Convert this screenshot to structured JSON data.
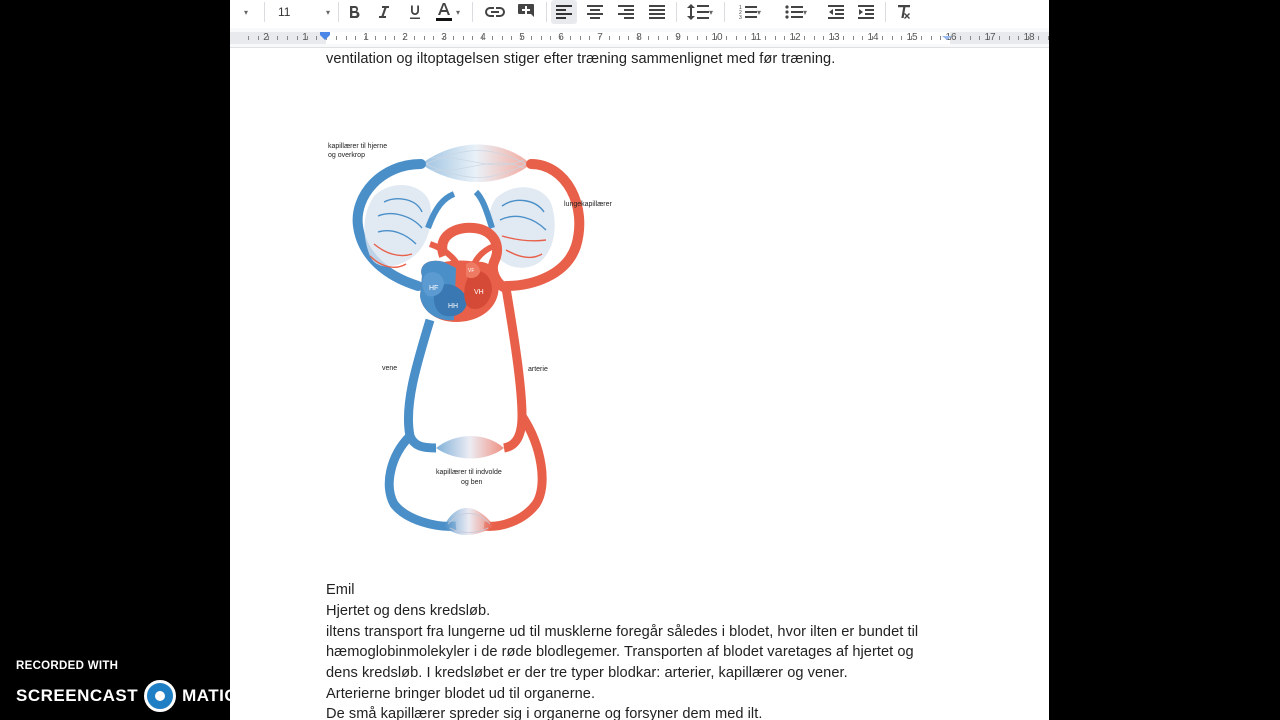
{
  "toolbar": {
    "font_size": "11",
    "font_size_caret": "▾",
    "style_caret": "▾"
  },
  "ruler": {
    "numbers": [
      "2",
      "1",
      "1",
      "2",
      "3",
      "4",
      "5",
      "6",
      "7",
      "8",
      "9",
      "10",
      "11",
      "12",
      "13",
      "14",
      "15",
      "16",
      "17",
      "18"
    ]
  },
  "document": {
    "top_line": "ventilation og iltoptagelsen stiger efter træning sammenlignet med før træning.",
    "figure": {
      "label_brain": "kapillærer til hjerne",
      "label_brain2": "og overkrop",
      "label_lung": "lungekapillærer",
      "label_vene": "vene",
      "label_arterie": "arterie",
      "label_gut": "kapillærer til indvolde",
      "label_gut2": "og ben",
      "label_hf": "HF",
      "label_hh": "HH",
      "label_vh": "VH",
      "label_vf": "VF"
    },
    "lines": [
      "Emil",
      "Hjertet og dens kredsløb.",
      "iltens transport fra lungerne ud til musklerne foregår således i blodet, hvor ilten er bundet til",
      "hæmoglobinmolekyler i de røde blodlegemer. Transporten af blodet varetages af hjertet og",
      "dens kredsløb. I kredsløbet er der tre typer blodkar: arterier, kapillærer og vener.",
      "Arterierne bringer blodet ud til organerne.",
      "De små kapillærer spreder sig i organerne og forsyner dem med ilt."
    ]
  },
  "watermark": {
    "recorded": "RECORDED WITH",
    "brand_left": "SCREENCAST",
    "brand_right": "MATIC"
  },
  "colors": {
    "artery": "#e8604a",
    "vein": "#4a8fc8",
    "text": "#222222"
  }
}
